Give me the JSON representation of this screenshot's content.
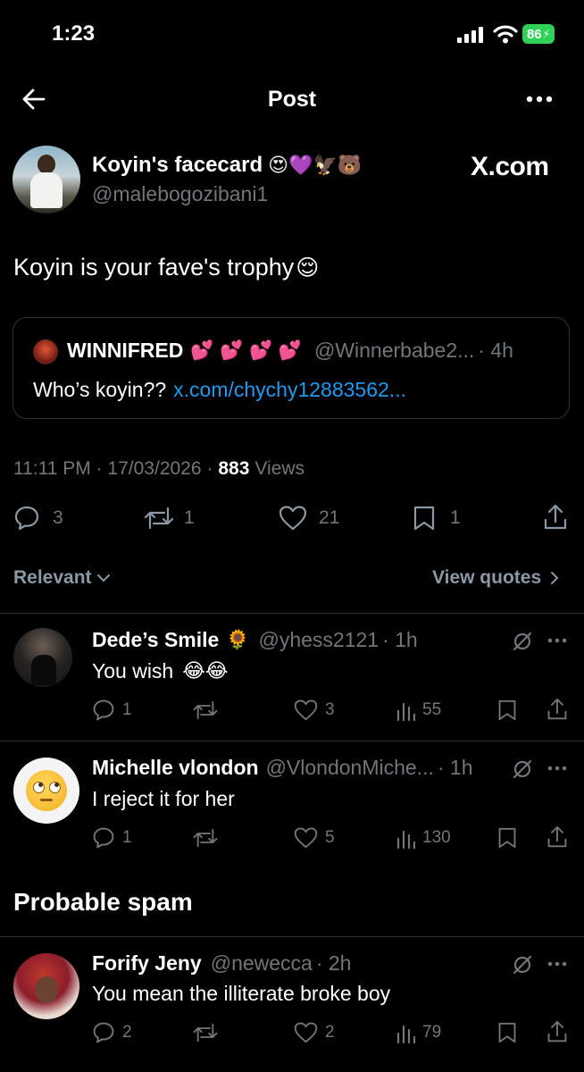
{
  "status_bar": {
    "time": "1:23",
    "battery": "86"
  },
  "header": {
    "title": "Post"
  },
  "post": {
    "display_name": "Koyin's facecard",
    "name_emojis": "😍💜🦅🐻",
    "handle": "@malebogozibani1",
    "watermark": "X.com",
    "text": "Koyin is your fave's trophy",
    "text_emoji": "😌",
    "quote": {
      "name": "WINNIFRED",
      "name_emojis": "💕 💕 💕 💕",
      "handle": "@Winnerbabe2...",
      "time": "· 4h",
      "text": "Who’s koyin??",
      "link": "x.com/chychy12883562..."
    },
    "meta": {
      "time_date": "11:11 PM · 17/03/2026 ·",
      "views_count": "883",
      "views_label": "Views"
    },
    "actions": {
      "replies": "3",
      "reposts": "1",
      "likes": "21",
      "bookmarks": "1"
    }
  },
  "filter": {
    "sort_label": "Relevant",
    "view_quotes": "View quotes"
  },
  "replies": [
    {
      "name": "Dede’s Smile",
      "name_emoji": "🌻",
      "handle": "@yhess2121",
      "time": "· 1h",
      "text": "You wish",
      "text_emoji": "😂😂",
      "replies": "1",
      "reposts": "",
      "likes": "3",
      "views": "55"
    },
    {
      "name": "Michelle vlondon",
      "name_emoji": "",
      "handle": "@VlondonMiche...",
      "time": "· 1h",
      "text": "I reject it for her",
      "text_emoji": "",
      "replies": "1",
      "reposts": "",
      "likes": "5",
      "views": "130"
    }
  ],
  "spam_section": {
    "title": "Probable spam",
    "reply": {
      "name": "Forify Jeny",
      "handle": "@newecca",
      "time": "· 2h",
      "text": "You mean the illiterate broke boy",
      "replies": "2",
      "reposts": "",
      "likes": "2",
      "views": "79"
    }
  },
  "colors": {
    "background": "#000000",
    "text": "#e7e9ea",
    "muted": "#71767b",
    "link": "#1d9bf0",
    "divider": "#2f3336",
    "battery": "#30d158"
  }
}
